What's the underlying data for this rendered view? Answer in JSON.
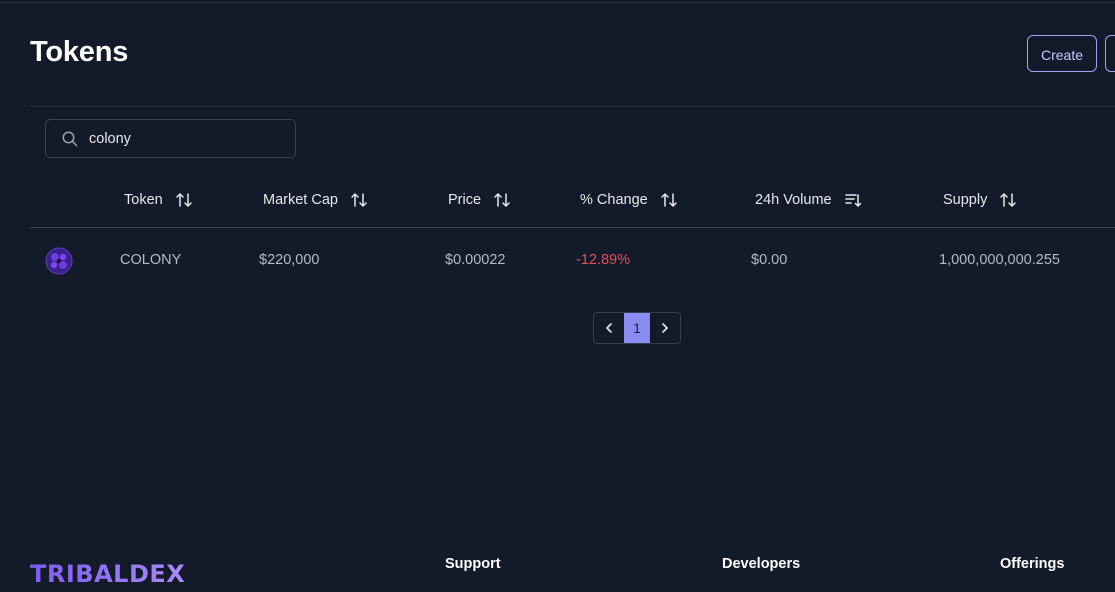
{
  "page": {
    "title": "Tokens"
  },
  "actions": {
    "create_label": "Create"
  },
  "search": {
    "value": "colony",
    "placeholder": ""
  },
  "table": {
    "columns": [
      "Token",
      "Market Cap",
      "Price",
      "% Change",
      "24h Volume",
      "Supply"
    ],
    "rows": [
      {
        "token": "COLONY",
        "market_cap": "$220,000",
        "price": "$0.00022",
        "change": "-12.89%",
        "volume": "$0.00",
        "supply": "1,000,000,000.255"
      }
    ]
  },
  "pagination": {
    "current": "1"
  },
  "footer": {
    "logo": "TRIBALDEX",
    "columns": [
      "Support",
      "Developers",
      "Offerings"
    ]
  },
  "colors": {
    "background": "#131a2a",
    "accent": "#8b8af0",
    "negative": "#e0505a",
    "logo": "#8b7cf6"
  },
  "icons": {
    "search": "search-icon",
    "sort": "sort-arrows-icon",
    "sort_active": "sort-descending-icon",
    "prev": "chevron-left-icon",
    "next": "chevron-right-icon"
  }
}
